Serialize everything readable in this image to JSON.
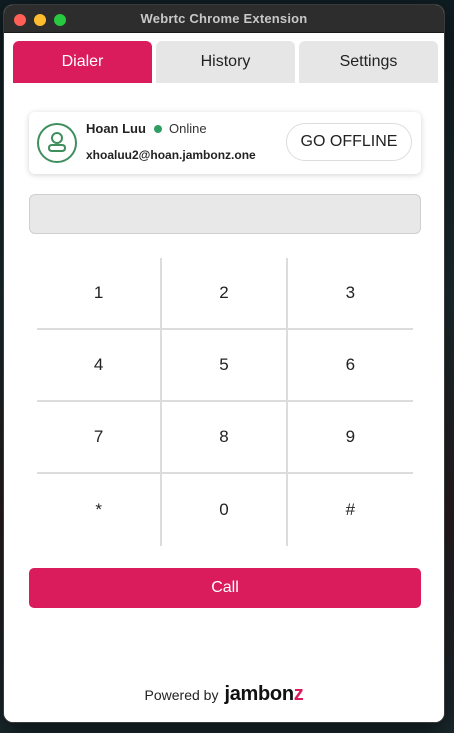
{
  "window": {
    "title": "Webrtc Chrome Extension"
  },
  "tabs": [
    {
      "label": "Dialer",
      "active": true
    },
    {
      "label": "History",
      "active": false
    },
    {
      "label": "Settings",
      "active": false
    }
  ],
  "user": {
    "name": "Hoan Luu",
    "status": "Online",
    "email": "xhoaluu2@hoan.jambonz.one",
    "status_color": "#2f9e63",
    "avatar_icon": "user-icon"
  },
  "offline_button": {
    "label": "GO OFFLINE"
  },
  "dial_input": {
    "value": "",
    "placeholder": ""
  },
  "keypad": {
    "keys": [
      "1",
      "2",
      "3",
      "4",
      "5",
      "6",
      "7",
      "8",
      "9",
      "*",
      "0",
      "#"
    ]
  },
  "call_button": {
    "label": "Call"
  },
  "footer": {
    "powered_by": "Powered by",
    "brand_main": "jambon",
    "brand_accent": "z"
  },
  "colors": {
    "accent": "#da1c5c",
    "tab_inactive": "#e6e6e6",
    "online": "#2f9e63"
  }
}
